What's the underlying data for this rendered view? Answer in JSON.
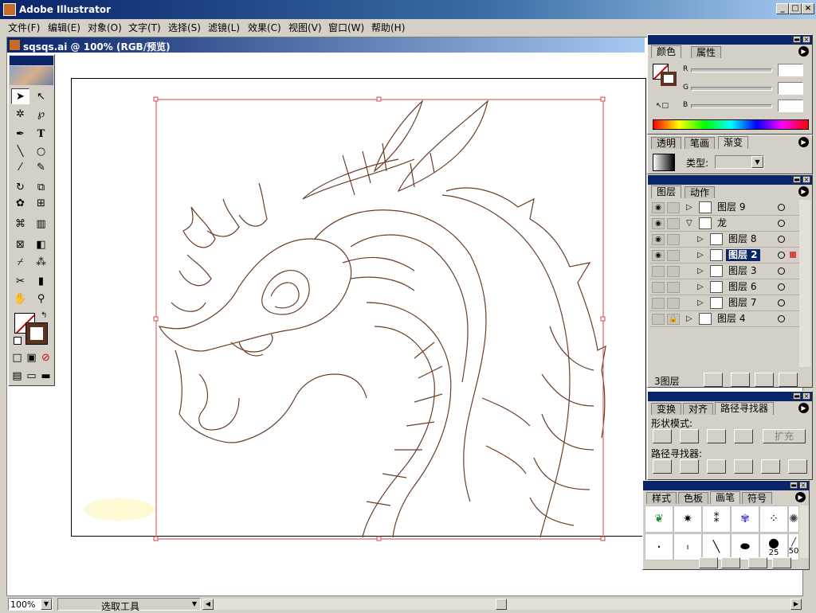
{
  "app": {
    "title": "Adobe Illustrator"
  },
  "menu": [
    "文件(F)",
    "编辑(E)",
    "对象(O)",
    "文字(T)",
    "选择(S)",
    "滤镜(L)",
    "效果(C)",
    "视图(V)",
    "窗口(W)",
    "帮助(H)"
  ],
  "document": {
    "title": "sqsqs.ai @ 100% (RGB/预览)"
  },
  "color_panel": {
    "tabs": [
      "颜色",
      "属性"
    ],
    "channels": [
      "R",
      "G",
      "B"
    ],
    "stroke_color": "#5a3420"
  },
  "gradient_panel": {
    "tabs": [
      "透明",
      "笔画",
      "渐变"
    ],
    "type_label": "类型:"
  },
  "layers_panel": {
    "tabs": [
      "图层",
      "动作"
    ],
    "rows": [
      {
        "name": "图层 9",
        "indent": 0,
        "visible": true,
        "expanded": false,
        "selected": false,
        "locked": false
      },
      {
        "name": "龙",
        "indent": 0,
        "visible": true,
        "expanded": true,
        "selected": false,
        "locked": false
      },
      {
        "name": "图层 8",
        "indent": 1,
        "visible": true,
        "expanded": false,
        "selected": false,
        "locked": false
      },
      {
        "name": "图层 2",
        "indent": 1,
        "visible": true,
        "expanded": false,
        "selected": true,
        "locked": false
      },
      {
        "name": "图层 3",
        "indent": 1,
        "visible": false,
        "expanded": false,
        "selected": false,
        "locked": false
      },
      {
        "name": "图层 6",
        "indent": 1,
        "visible": false,
        "expanded": false,
        "selected": false,
        "locked": false
      },
      {
        "name": "图层 7",
        "indent": 1,
        "visible": false,
        "expanded": false,
        "selected": false,
        "locked": false
      },
      {
        "name": "图层 4",
        "indent": 0,
        "visible": false,
        "expanded": false,
        "selected": false,
        "locked": true
      }
    ],
    "count": "3图层"
  },
  "pathfinder_panel": {
    "tabs": [
      "变换",
      "对齐",
      "路径寻找器"
    ],
    "shape_modes_label": "形状模式:",
    "pathfinders_label": "路径寻找器:",
    "expand_label": "扩充"
  },
  "brushes_panel": {
    "tabs": [
      "样式",
      "色板",
      "画笔",
      "符号"
    ],
    "sizes": [
      "25",
      "50"
    ]
  },
  "status": {
    "zoom": "100%",
    "tool": "选取工具"
  }
}
